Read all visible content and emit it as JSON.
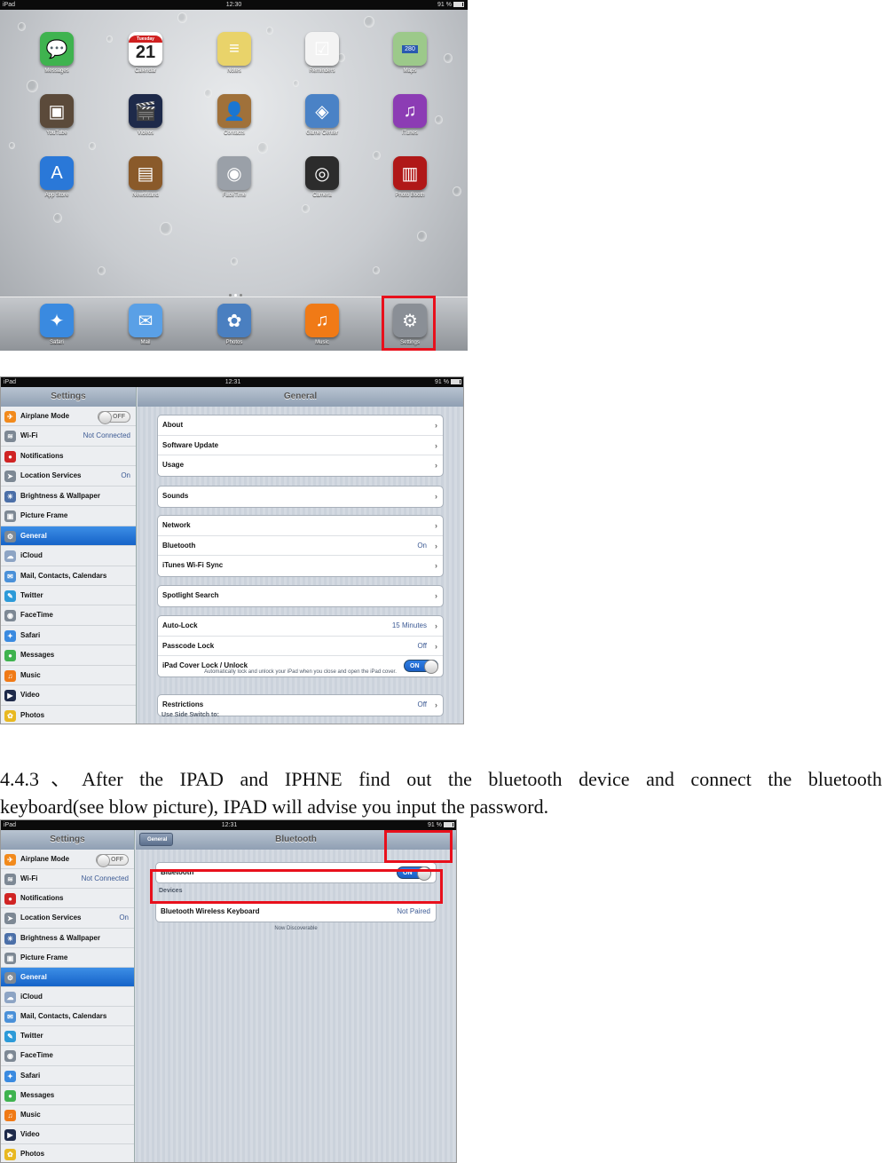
{
  "home_screen": {
    "status": {
      "device": "iPad",
      "time": "12:30",
      "battery": "91 %"
    },
    "apps": [
      {
        "label": "Messages",
        "icon": "messages-icon",
        "color": "#3fb34f",
        "glyph": "💬"
      },
      {
        "label": "Calendar",
        "icon": "calendar-icon",
        "color": "#ffffff",
        "glyph": "21",
        "day": "Tuesday"
      },
      {
        "label": "Notes",
        "icon": "notes-icon",
        "color": "#e9d36a",
        "glyph": "≡"
      },
      {
        "label": "Reminders",
        "icon": "reminders-icon",
        "color": "#f3f3f3",
        "glyph": "☑"
      },
      {
        "label": "Maps",
        "icon": "maps-icon",
        "color": "#9cc98a",
        "glyph": "280"
      },
      {
        "label": "YouTube",
        "icon": "youtube-icon",
        "color": "#5b4a3a",
        "glyph": "▣"
      },
      {
        "label": "Videos",
        "icon": "videos-icon",
        "color": "#1e2a4a",
        "glyph": "🎬"
      },
      {
        "label": "Contacts",
        "icon": "contacts-icon",
        "color": "#a0713a",
        "glyph": "👤"
      },
      {
        "label": "Game Center",
        "icon": "game-center-icon",
        "color": "#4a82c6",
        "glyph": "◈"
      },
      {
        "label": "iTunes",
        "icon": "itunes-icon",
        "color": "#8c3cb4",
        "glyph": "♫"
      },
      {
        "label": "App Store",
        "icon": "app-store-icon",
        "color": "#2a78d8",
        "glyph": "A"
      },
      {
        "label": "Newsstand",
        "icon": "newsstand-icon",
        "color": "#8a5a2a",
        "glyph": "▤"
      },
      {
        "label": "FaceTime",
        "icon": "facetime-icon",
        "color": "#9aa0a8",
        "glyph": "◉"
      },
      {
        "label": "Camera",
        "icon": "camera-icon",
        "color": "#2c2c2c",
        "glyph": "◎"
      },
      {
        "label": "Photo Booth",
        "icon": "photo-booth-icon",
        "color": "#b01818",
        "glyph": "▥"
      }
    ],
    "dock": [
      {
        "label": "Safari",
        "icon": "safari-icon",
        "color": "#3a8ae0",
        "glyph": "✦"
      },
      {
        "label": "Mail",
        "icon": "mail-icon",
        "color": "#5aa0e6",
        "glyph": "✉"
      },
      {
        "label": "Photos",
        "icon": "photos-icon",
        "color": "#4a7fc0",
        "glyph": "✿"
      },
      {
        "label": "Music",
        "icon": "music-icon",
        "color": "#f07a16",
        "glyph": "♫"
      },
      {
        "label": "Settings",
        "icon": "settings-icon",
        "color": "#8a8f96",
        "glyph": "⚙"
      }
    ]
  },
  "sidebar": {
    "title": "Settings",
    "items": [
      {
        "label": "Airplane Mode",
        "icon": "airplane-icon",
        "color": "#f28a1c",
        "glyph": "✈",
        "toggle": "OFF"
      },
      {
        "label": "Wi-Fi",
        "icon": "wifi-icon",
        "color": "#7d8894",
        "glyph": "≋",
        "value": "Not Connected"
      },
      {
        "label": "Notifications",
        "icon": "notifications-icon",
        "color": "#d02424",
        "glyph": "●"
      },
      {
        "label": "Location Services",
        "icon": "location-icon",
        "color": "#7d8894",
        "glyph": "➤",
        "value": "On"
      },
      {
        "label": "Brightness & Wallpaper",
        "icon": "brightness-icon",
        "color": "#4b6fa8",
        "glyph": "☀"
      },
      {
        "label": "Picture Frame",
        "icon": "picture-frame-icon",
        "color": "#7d8894",
        "glyph": "▣"
      },
      {
        "label": "General",
        "icon": "general-icon",
        "color": "#7d8894",
        "glyph": "⚙",
        "selected": true
      },
      {
        "label": "iCloud",
        "icon": "icloud-icon",
        "color": "#8da4c4",
        "glyph": "☁"
      },
      {
        "label": "Mail, Contacts, Calendars",
        "icon": "mail-contacts-icon",
        "color": "#4a90d8",
        "glyph": "✉"
      },
      {
        "label": "Twitter",
        "icon": "twitter-icon",
        "color": "#2c9ad8",
        "glyph": "✎"
      },
      {
        "label": "FaceTime",
        "icon": "facetime-small-icon",
        "color": "#7d8894",
        "glyph": "◉"
      },
      {
        "label": "Safari",
        "icon": "safari-small-icon",
        "color": "#3a8ae0",
        "glyph": "✦"
      },
      {
        "label": "Messages",
        "icon": "messages-small-icon",
        "color": "#3fb34f",
        "glyph": "●"
      },
      {
        "label": "Music",
        "icon": "music-small-icon",
        "color": "#f07a16",
        "glyph": "♫"
      },
      {
        "label": "Video",
        "icon": "video-small-icon",
        "color": "#1e2a4a",
        "glyph": "▶"
      },
      {
        "label": "Photos",
        "icon": "photos-small-icon",
        "color": "#e8b820",
        "glyph": "✿"
      }
    ]
  },
  "general_screen": {
    "status": {
      "device": "iPad",
      "time": "12:31",
      "battery": "91 %"
    },
    "title": "General",
    "groups": [
      [
        {
          "label": "About"
        },
        {
          "label": "Software Update"
        },
        {
          "label": "Usage"
        }
      ],
      [
        {
          "label": "Sounds"
        }
      ],
      [
        {
          "label": "Network"
        },
        {
          "label": "Bluetooth",
          "value": "On"
        },
        {
          "label": "iTunes Wi-Fi Sync"
        }
      ],
      [
        {
          "label": "Spotlight Search"
        }
      ],
      [
        {
          "label": "Auto-Lock",
          "value": "15 Minutes"
        },
        {
          "label": "Passcode Lock",
          "value": "Off"
        },
        {
          "label": "iPad Cover Lock / Unlock",
          "toggle": "ON"
        }
      ],
      [
        {
          "label": "Restrictions",
          "value": "Off"
        }
      ]
    ],
    "cover_note": "Automatically lock and unlock your iPad when you close and open the iPad cover.",
    "side_switch_header": "Use Side Switch to:"
  },
  "instruction_text": {
    "line1": "4.4.3、After the IPAD and IPHNE find out the bluetooth device and connect the bluetooth",
    "line2": "keyboard(see blow picture), IPAD will advise you input the password."
  },
  "bluetooth_screen": {
    "status": {
      "device": "iPad",
      "time": "12:31",
      "battery": "91 %"
    },
    "title": "Bluetooth",
    "back_label": "General",
    "bluetooth_label": "Bluetooth",
    "bluetooth_toggle": "ON",
    "devices_header": "Devices",
    "device_name": "Bluetooth Wireless Keyboard",
    "device_status": "Not Paired",
    "discoverable": "Now Discoverable"
  },
  "colors": {
    "highlight": "#e8101c",
    "selection": "#1563c8"
  }
}
